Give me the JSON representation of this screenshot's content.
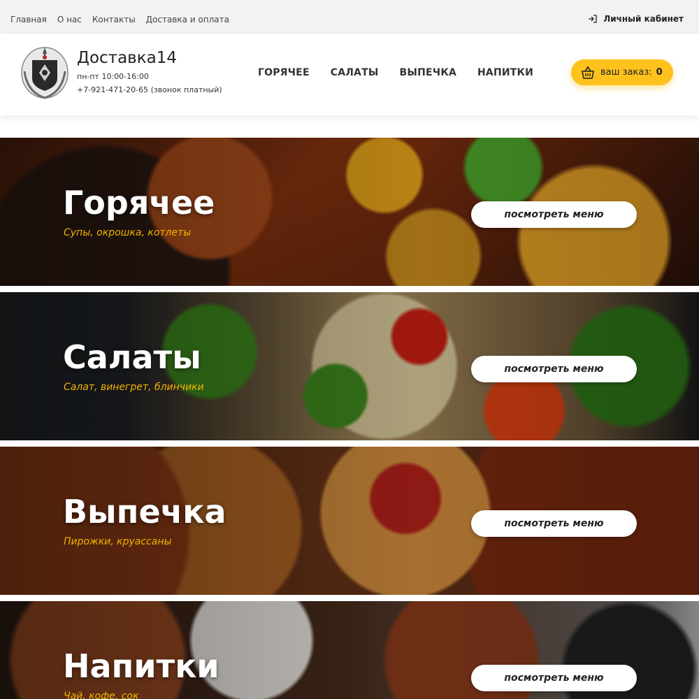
{
  "topbar": {
    "links": [
      "Главная",
      "О нас",
      "Контакты",
      "Доставка и оплата"
    ],
    "account_label": "Личный кабинет"
  },
  "header": {
    "brand": "Доставка14",
    "hours": "пн-пт 10:00-16:00",
    "phone": "+7-921-471-20-65 (звонок платный)",
    "nav": [
      "ГОРЯЧЕЕ",
      "САЛАТЫ",
      "ВЫПЕЧКА",
      "НАПИТКИ"
    ],
    "cart_label": "ваш заказ:",
    "cart_count": "0"
  },
  "categories": [
    {
      "title": "Горячее",
      "subtitle": "Супы, окрошка, котлеты",
      "button": "посмотреть меню"
    },
    {
      "title": "Салаты",
      "subtitle": "Салат, винегрет, блинчики",
      "button": "посмотреть меню"
    },
    {
      "title": "Выпечка",
      "subtitle": "Пирожки, круассаны",
      "button": "посмотреть меню"
    },
    {
      "title": "Напитки",
      "subtitle": "Чай, кофе, сок",
      "button": "посмотреть меню"
    }
  ],
  "colors": {
    "accent": "#fdc21c",
    "subtitle": "#f5b400",
    "topbar_bg": "#f2f2f2"
  },
  "icons": {
    "account": "login-arrow-icon",
    "cart": "basket-icon",
    "logo": "emblem-logo"
  }
}
